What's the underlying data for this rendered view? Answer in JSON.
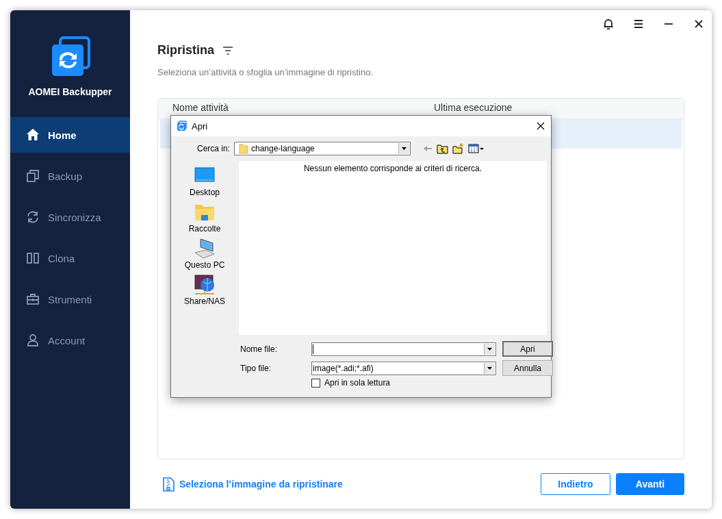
{
  "app": {
    "name": "AOMEI Backupper"
  },
  "sidebar": {
    "items": [
      {
        "label": "Home",
        "selected": true
      },
      {
        "label": "Backup",
        "selected": false
      },
      {
        "label": "Sincronizza",
        "selected": false
      },
      {
        "label": "Clona",
        "selected": false
      },
      {
        "label": "Strumenti",
        "selected": false
      },
      {
        "label": "Account",
        "selected": false
      }
    ]
  },
  "page": {
    "title": "Ripristina",
    "subtitle": "Seleziona un’attività o sfoglia un’immagine di ripristino."
  },
  "table": {
    "columns": [
      "Nome attività",
      "Ultima esecuzione"
    ],
    "rows": [
      {
        "selected": true
      }
    ]
  },
  "dialog": {
    "title": "Apri",
    "look_in_label": "Cerca in:",
    "look_in_value": "change-language",
    "places": [
      {
        "label": "Desktop"
      },
      {
        "label": "Raccolte"
      },
      {
        "label": "Questo PC"
      },
      {
        "label": "Share/NAS"
      }
    ],
    "empty_message": "Nessun elemento corrisponde ai criteri di ricerca.",
    "file_name_label": "Nome file:",
    "file_type_label": "Tipo file:",
    "file_type_value": "image(*.adi;*.afi)",
    "open_button": "Apri",
    "cancel_button": "Annulla",
    "read_only": {
      "label": "Apri in sola lettura",
      "checked": false
    }
  },
  "footer": {
    "link": "Seleziona l’immagine da ripristinare",
    "buttons": [
      {
        "label": "Indietro",
        "kind": "secondary"
      },
      {
        "label": "Avanti",
        "kind": "primary"
      }
    ]
  }
}
